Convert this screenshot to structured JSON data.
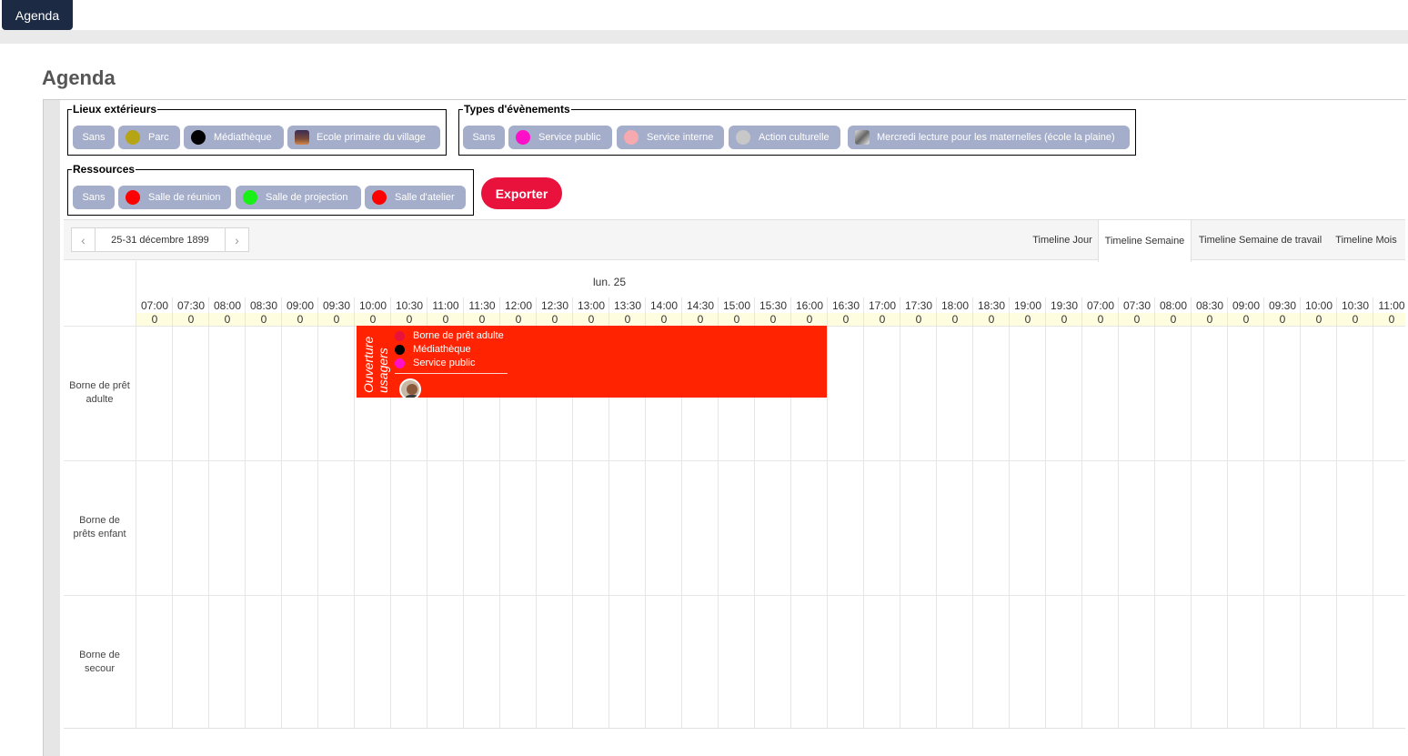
{
  "nav": {
    "tab_label": "Agenda"
  },
  "page": {
    "title": "Agenda"
  },
  "filters": {
    "lieux": {
      "legend": "Lieux extérieurs",
      "chips": [
        {
          "label": "Sans",
          "dot": null
        },
        {
          "label": "Parc",
          "dot": "#b5a414"
        },
        {
          "label": "Médiathèque",
          "dot": "#000000"
        },
        {
          "label": "Ecole primaire du village",
          "icon": "school-image-icon"
        }
      ]
    },
    "types": {
      "legend": "Types d'évènements",
      "chips": [
        {
          "label": "Sans",
          "dot": null
        },
        {
          "label": "Service public",
          "dot": "#ff10c8"
        },
        {
          "label": "Service interne",
          "dot": "#f7a9b0"
        },
        {
          "label": "Action culturelle",
          "dot": "#c8c8c8"
        },
        {
          "label": "Mercredi lecture pour les maternelles (école la plaine)",
          "icon": "book-image-icon"
        }
      ]
    },
    "ressources": {
      "legend": "Ressources",
      "chips": [
        {
          "label": "Sans",
          "dot": null
        },
        {
          "label": "Salle de réunion",
          "dot": "#ff0000"
        },
        {
          "label": "Salle de projection",
          "dot": "#18f018"
        },
        {
          "label": "Salle d'atelier",
          "dot": "#ff0000"
        }
      ]
    }
  },
  "export_label": "Exporter",
  "toolbar": {
    "range": "25-31 décembre 1899",
    "views": [
      "Timeline Jour",
      "Timeline Semaine",
      "Timeline Semaine de travail",
      "Timeline Mois"
    ],
    "active_view": "Timeline Semaine"
  },
  "schedule": {
    "day": "lun. 25",
    "times": [
      "07:00",
      "07:30",
      "08:00",
      "08:30",
      "09:00",
      "09:30",
      "10:00",
      "10:30",
      "11:00",
      "11:30",
      "12:00",
      "12:30",
      "13:00",
      "13:30",
      "14:00",
      "14:30",
      "15:00",
      "15:30",
      "16:00",
      "16:30",
      "17:00",
      "17:30",
      "18:00",
      "18:30",
      "19:00",
      "19:30",
      "07:00",
      "07:30",
      "08:00",
      "08:30",
      "09:00",
      "09:30",
      "10:00",
      "10:30",
      "11:00"
    ],
    "counts": [
      "0",
      "0",
      "0",
      "0",
      "0",
      "0",
      "0",
      "0",
      "0",
      "0",
      "0",
      "0",
      "0",
      "0",
      "0",
      "0",
      "0",
      "0",
      "0",
      "0",
      "0",
      "0",
      "0",
      "0",
      "0",
      "0",
      "0",
      "0",
      "0",
      "0",
      "0",
      "0",
      "0",
      "0",
      "0"
    ],
    "resources": [
      "Borne de prêt adulte",
      "Borne de prêts enfant",
      "Borne de secour"
    ],
    "event": {
      "title": "Ouverture usagers",
      "color": "#ff2301",
      "start": "10:00",
      "end": "16:30",
      "resource": "Borne de prêt adulte",
      "lines": [
        {
          "label": "Borne de prêt adulte",
          "dot": "#e8123c"
        },
        {
          "label": "Médiathèque",
          "dot": "#000000"
        },
        {
          "label": "Service public",
          "dot": "#ff10c8"
        }
      ]
    }
  }
}
